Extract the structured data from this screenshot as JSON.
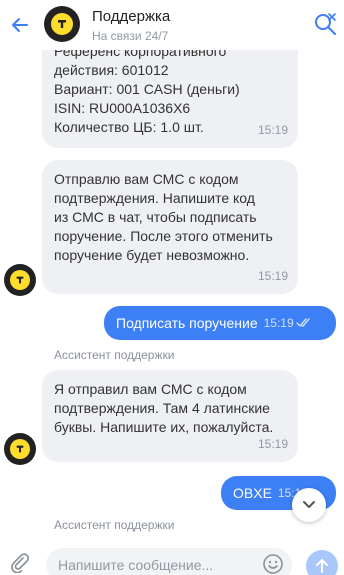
{
  "header": {
    "title": "Поддержка",
    "status": "На связи 24/7"
  },
  "messages": {
    "m1": {
      "text": "Референс корпоративного\nдействия: 601012\nВариант: 001 CASH (деньги)\nISIN: RU000A1036X6\nКоличество ЦБ: 1.0 шт.",
      "time": "15:19"
    },
    "m2": {
      "text": "Отправлю вам СМС с кодом\nподтверждения. Напишите код\nиз СМС в чат, чтобы подписать\nпоручение. После этого отменить\nпоручение будет невозможно.",
      "time": "15:19"
    },
    "m3": {
      "text": "Подписать поручение",
      "time": "15:19"
    },
    "sender1": "Ассистент поддержки",
    "m4": {
      "text": "Я отправил вам СМС с кодом\nподтверждения. Там 4 латинские\nбуквы. Напишите их, пожалуйста.",
      "time": "15:19"
    },
    "m5": {
      "text": "OBXE",
      "time": "15:19"
    },
    "sender2": "Ассистент поддержки"
  },
  "composer": {
    "placeholder": "Напишите сообщение..."
  },
  "colors": {
    "accent": "#3d7ff5",
    "bubble": "#eef0f4",
    "brand_yellow": "#ffdd2d"
  }
}
